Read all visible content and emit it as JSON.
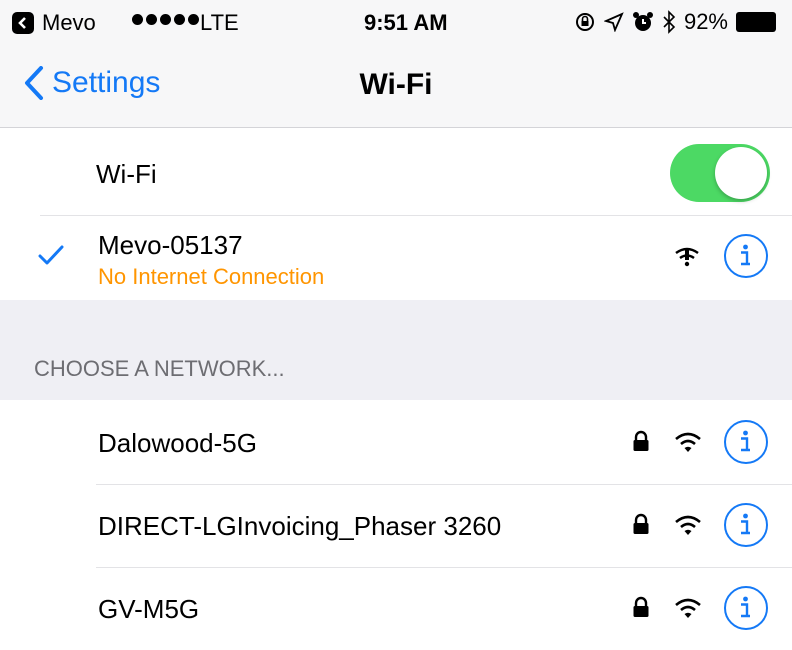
{
  "status_bar": {
    "app_name": "Mevo",
    "network": "LTE",
    "time": "9:51 AM",
    "battery": "92%"
  },
  "nav": {
    "back_label": "Settings",
    "title": "Wi-Fi"
  },
  "wifi_toggle": {
    "label": "Wi-Fi",
    "on": true,
    "color": "#4cd964"
  },
  "connected": {
    "name": "Mevo-05137",
    "status": "No Internet Connection",
    "status_color": "#ff9500"
  },
  "section_header": "CHOOSE A NETWORK...",
  "networks": [
    {
      "name": "Dalowood-5G",
      "locked": true
    },
    {
      "name": "DIRECT-LGInvoicing_Phaser 3260",
      "locked": true
    },
    {
      "name": "GV-M5G",
      "locked": true
    }
  ],
  "colors": {
    "accent": "#1479f6",
    "group_bg": "#efeff4"
  }
}
